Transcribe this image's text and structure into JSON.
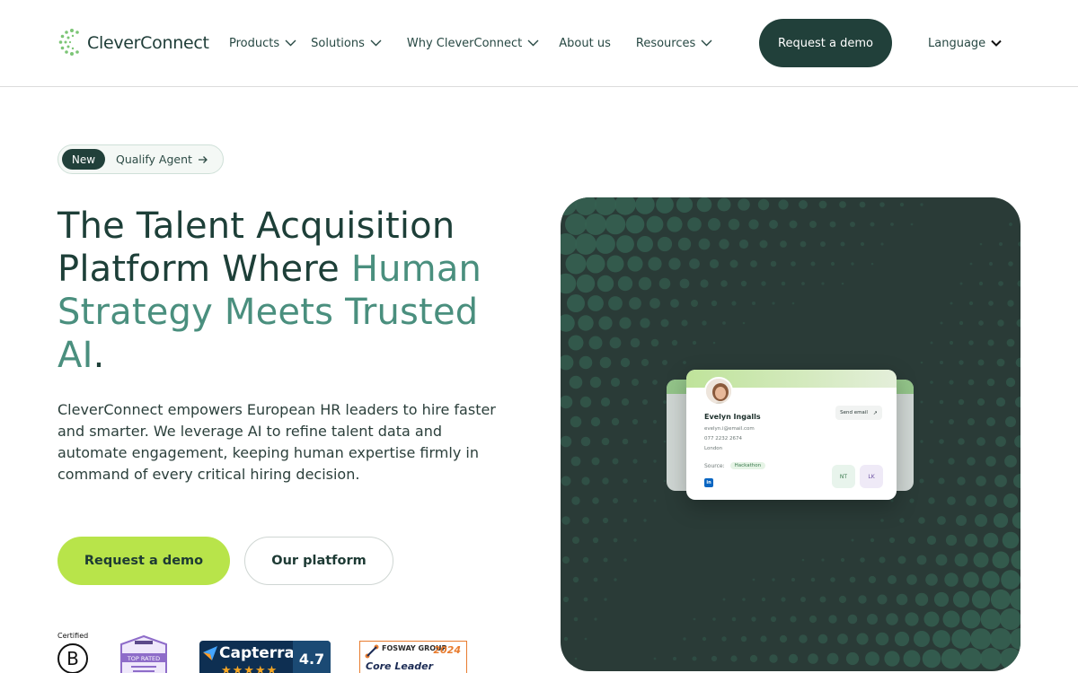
{
  "brand": {
    "name": "CleverConnect"
  },
  "nav": {
    "items": [
      {
        "label": "Products",
        "has_dropdown": true
      },
      {
        "label": "Solutions",
        "has_dropdown": true
      },
      {
        "label": "Why CleverConnect",
        "has_dropdown": true
      },
      {
        "label": "About us",
        "has_dropdown": false
      },
      {
        "label": "Resources",
        "has_dropdown": true
      }
    ],
    "cta_label": "Request a demo",
    "language_label": "Language"
  },
  "announcement": {
    "tag": "New",
    "label": "Qualify Agent"
  },
  "hero": {
    "title_part1": "The Talent Acquisition Platform Where",
    "title_part2": "Human Strategy Meets Trusted AI",
    "title_end": ".",
    "description": "CleverConnect empowers European HR leaders to hire faster and smarter. We leverage AI to refine talent data and automate engagement, keeping human expertise firmly in command of every critical hiring decision.",
    "primary_cta": "Request a demo",
    "secondary_cta": "Our platform"
  },
  "certifications": {
    "bcorp_label": "Certified",
    "bcorp_letter": "B",
    "top_rated_label": "TOP RATED",
    "capterra_name": "Capterra",
    "capterra_score": "4.7",
    "fosway_group": "FOSWAY GROUP",
    "fosway_year": "2024",
    "fosway_rank": "Core Leader"
  },
  "profile_card": {
    "name": "Evelyn Ingalls",
    "email": "evelyn.i@email.com",
    "phone": "077 2232 2674",
    "city": "London",
    "source_label": "Source:",
    "source_value": "Hackathon",
    "send_label": "Send email",
    "chip_1": "NT",
    "chip_2": "LK",
    "linkedin_label": "in"
  },
  "colors": {
    "brand_dark": "#21403a",
    "accent_green": "#4a8f7e",
    "lime": "#b8e44a",
    "panel": "#2a3b37"
  }
}
